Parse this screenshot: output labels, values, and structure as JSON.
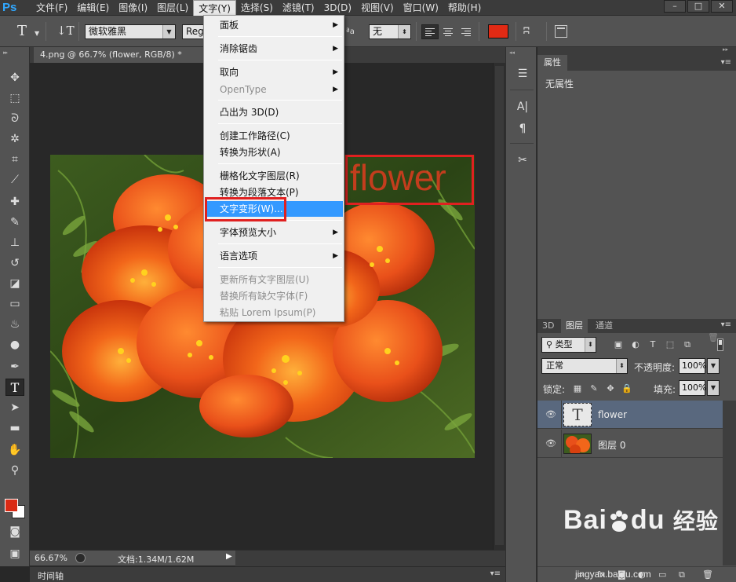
{
  "app": {
    "logo": "Ps"
  },
  "menubar": {
    "items": [
      "文件(F)",
      "编辑(E)",
      "图像(I)",
      "图层(L)",
      "文字(Y)",
      "选择(S)",
      "滤镜(T)",
      "3D(D)",
      "视图(V)",
      "窗口(W)",
      "帮助(H)"
    ],
    "active": "文字(Y)",
    "window_buttons": [
      "–",
      "□",
      "✕"
    ]
  },
  "options": {
    "tool_icon": "T",
    "orient_icon": "↓T",
    "font_family": "微软雅黑",
    "font_style": "Reg",
    "aa_label": "ªa",
    "aa_value": "无",
    "text_color": "#e12a14"
  },
  "document": {
    "tab_title": "4.png @ 66.7% (flower, RGB/8) *",
    "close": "×",
    "canvas_text": "flower",
    "zoom": "66.67%",
    "doc_size": "文档:1.34M/1.62M",
    "timeline_label": "时间轴"
  },
  "type_menu": {
    "items": [
      {
        "label": "面板",
        "submenu": true,
        "disabled": false
      },
      {
        "label": "消除锯齿",
        "submenu": true,
        "disabled": false
      },
      {
        "label": "取向",
        "submenu": true,
        "disabled": false
      },
      {
        "label": "OpenType",
        "submenu": true,
        "disabled": true
      },
      {
        "label": "凸出为 3D(D)",
        "submenu": false,
        "disabled": false
      },
      {
        "label": "创建工作路径(C)",
        "submenu": false,
        "disabled": false
      },
      {
        "label": "转换为形状(A)",
        "submenu": false,
        "disabled": false
      },
      {
        "label": "栅格化文字图层(R)",
        "submenu": false,
        "disabled": false
      },
      {
        "label": "转换为段落文本(P)",
        "submenu": false,
        "disabled": false
      },
      {
        "label": "文字变形(W)...",
        "submenu": false,
        "disabled": false,
        "highlighted": true
      },
      {
        "label": "字体预览大小",
        "submenu": true,
        "disabled": false
      },
      {
        "label": "语言选项",
        "submenu": true,
        "disabled": false
      },
      {
        "label": "更新所有文字图层(U)",
        "submenu": false,
        "disabled": true
      },
      {
        "label": "替换所有缺欠字体(F)",
        "submenu": false,
        "disabled": true
      },
      {
        "label": "粘贴 Lorem Ipsum(P)",
        "submenu": false,
        "disabled": true
      }
    ]
  },
  "properties_panel": {
    "tab": "属性",
    "body_text": "无属性"
  },
  "layers_panel": {
    "tabs": [
      "3D",
      "图层",
      "通道"
    ],
    "active_tab": "图层",
    "filter_kind": "类型",
    "blend_mode": "正常",
    "opacity_label": "不透明度:",
    "opacity_value": "100%",
    "lock_label": "锁定:",
    "fill_label": "填充:",
    "fill_value": "100%",
    "layers": [
      {
        "name": "flower",
        "type": "text",
        "thumb_glyph": "T",
        "selected": true
      },
      {
        "name": "图层 0",
        "type": "image",
        "selected": false
      }
    ]
  },
  "watermark": {
    "brand": "Bai",
    "brand_end": "du",
    "brand_cn": "经验",
    "url": "jingyan.baidu.com"
  }
}
